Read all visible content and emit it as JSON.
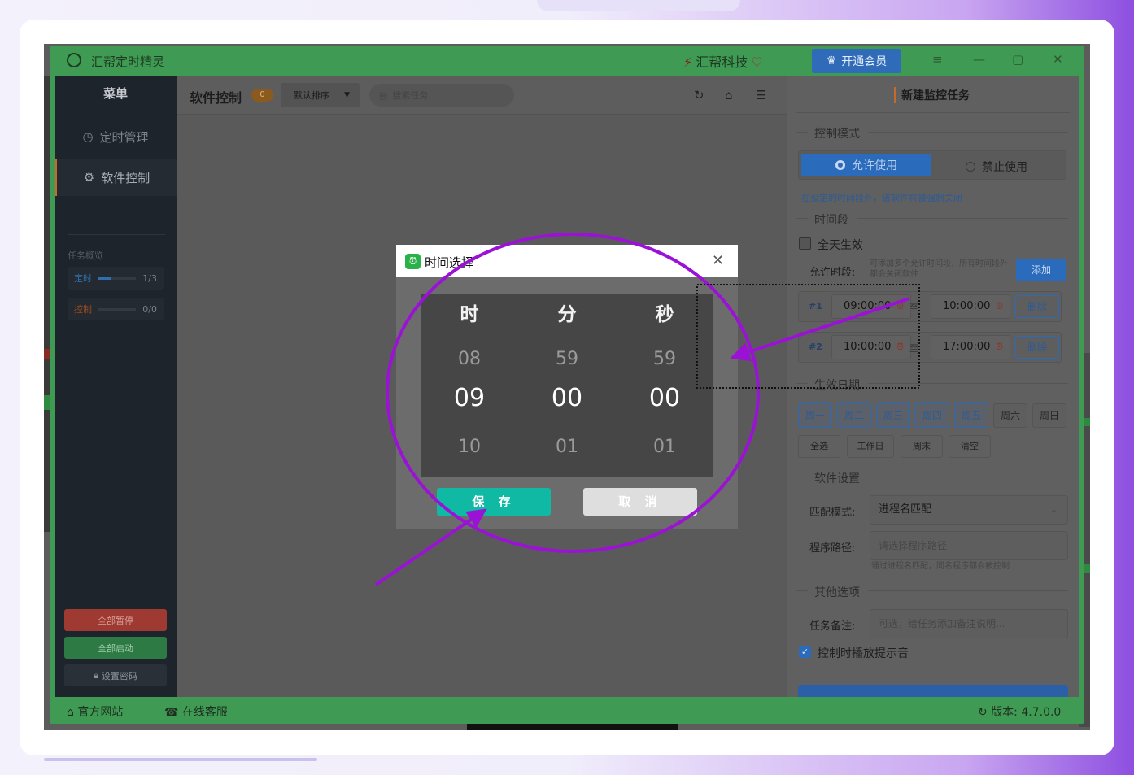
{
  "app": {
    "title": "汇帮定时精灵",
    "brand": "汇帮科技",
    "vip_button": "开通会员"
  },
  "sidebar": {
    "title": "菜单",
    "items": [
      {
        "label": "定时管理",
        "icon": "clock-icon"
      },
      {
        "label": "软件控制",
        "icon": "gear-icon"
      }
    ],
    "overview_title": "任务概览",
    "overview": [
      {
        "label": "定时",
        "value": "1/3",
        "progress": 0.33,
        "color": "#2f6fae"
      },
      {
        "label": "控制",
        "value": "0/0",
        "progress": 0,
        "color": "#9a4a1c"
      }
    ],
    "buttons": [
      {
        "label": "全部暂停",
        "color": "#9e3a32"
      },
      {
        "label": "全部启动",
        "color": "#2d7a45"
      },
      {
        "label": "设置密码",
        "color": "#2a3038"
      }
    ]
  },
  "toolbar": {
    "title": "软件控制",
    "count": "0",
    "sort": "默认排序",
    "search_placeholder": "搜索任务..."
  },
  "panel": {
    "title": "新建监控任务",
    "mode_section": "控制模式",
    "mode_allow": "允许使用",
    "mode_deny": "禁止使用",
    "mode_hint": "在设定的时间段外，该软件将被强制关闭",
    "period_section": "时间段",
    "all_day": "全天生效",
    "allow_label": "允许时段:",
    "allow_hint": "可添加多个允许时间段，所有时间段外都会关闭软件",
    "add_button": "添加",
    "periods": [
      {
        "no": "#1",
        "start": "09:00:00",
        "to": "至",
        "end": "10:00:00",
        "del": "删除"
      },
      {
        "no": "#2",
        "start": "10:00:00",
        "to": "至",
        "end": "17:00:00",
        "del": "删除"
      }
    ],
    "date_section": "生效日期",
    "days": [
      {
        "label": "周一",
        "on": true
      },
      {
        "label": "周二",
        "on": true
      },
      {
        "label": "周三",
        "on": true
      },
      {
        "label": "周四",
        "on": true
      },
      {
        "label": "周五",
        "on": true
      },
      {
        "label": "周六",
        "on": false
      },
      {
        "label": "周日",
        "on": false
      }
    ],
    "quick": [
      "全选",
      "工作日",
      "周末",
      "清空"
    ],
    "software_section": "软件设置",
    "match_label": "匹配模式:",
    "match_value": "进程名匹配",
    "path_label": "程序路径:",
    "path_placeholder": "请选择程序路径",
    "path_hint": "通过进程名匹配，同名程序都会被控制",
    "other_section": "其他选项",
    "note_label": "任务备注:",
    "note_placeholder": "可选，给任务添加备注说明...",
    "sound_label": "控制时播放提示音"
  },
  "status": {
    "website": "官方网站",
    "service": "在线客服",
    "version": "版本: 4.7.0.0"
  },
  "dialog": {
    "title": "时间选择",
    "columns": [
      {
        "header": "时",
        "prev": "08",
        "current": "09",
        "next": "10"
      },
      {
        "header": "分",
        "prev": "59",
        "current": "00",
        "next": "01"
      },
      {
        "header": "秒",
        "prev": "59",
        "current": "00",
        "next": "01"
      }
    ],
    "save": "保 存",
    "cancel": "取 消"
  },
  "colors": {
    "app_green": "#3f9b53",
    "accent_blue": "#2b6bbb",
    "save_teal": "#10b9a4",
    "annotation_purple": "#9b12d6"
  }
}
